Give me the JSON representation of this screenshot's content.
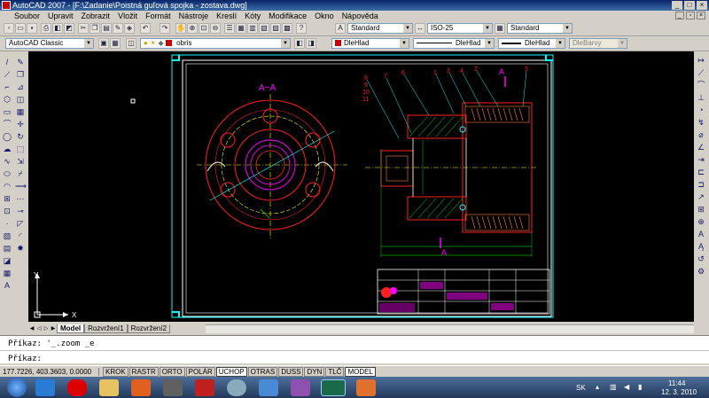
{
  "window": {
    "title": "AutoCAD 2007 - [F:\\Zadanie\\Poistná guľová spojka - zostava.dwg]",
    "buttons": [
      "_",
      "□",
      "×"
    ]
  },
  "menu": [
    "Soubor",
    "Upravit",
    "Zobrazit",
    "Vložit",
    "Formát",
    "Nástroje",
    "Kreslí",
    "Kóty",
    "Modifikace",
    "Okno",
    "Nápověda"
  ],
  "toolbar_styles": {
    "text_style": "Standard",
    "dim_style": "ISO-25",
    "table_style": "Standard"
  },
  "toolbar_props": {
    "workspace": "AutoCAD Classic",
    "layer": "obris",
    "color": "DleHlad",
    "linetype": "DleHlad",
    "lineweight": "DleHlad",
    "plotstyle": "DleBarvy"
  },
  "drawing": {
    "section_label": "A−A",
    "cut_label": "A",
    "part_numbers": [
      "8",
      "7",
      "9",
      "10",
      "11",
      "6",
      "1",
      "3",
      "4",
      "2",
      "5"
    ],
    "colors": {
      "background": "#000000",
      "outline": "#ffffff",
      "frame": "#00ffff",
      "dims": "#00ff00",
      "parts": "#ff2020",
      "hatch": "#ff8040",
      "centerline": "#ffff00",
      "magenta": "#ff00ff"
    }
  },
  "layout_tabs": [
    "Model",
    "Rozvržení1",
    "Rozvržení2"
  ],
  "command": {
    "line1": "Příkaz: '_.zoom _e",
    "line2": "Příkaz:"
  },
  "status": {
    "coords": "177.7226, 403.3603, 0.0000",
    "modes": [
      {
        "label": "KROK",
        "on": false
      },
      {
        "label": "RASTR",
        "on": false
      },
      {
        "label": "ORTO",
        "on": false
      },
      {
        "label": "POLÁR",
        "on": false
      },
      {
        "label": "UCHOP",
        "on": true
      },
      {
        "label": "OTRAS",
        "on": false
      },
      {
        "label": "DUSS",
        "on": false
      },
      {
        "label": "DYN",
        "on": false
      },
      {
        "label": "TLČ",
        "on": false
      },
      {
        "label": "MODEL",
        "on": true
      }
    ]
  },
  "tray": {
    "lang": "SK",
    "time": "11:44",
    "date": "12. 3. 2010"
  }
}
